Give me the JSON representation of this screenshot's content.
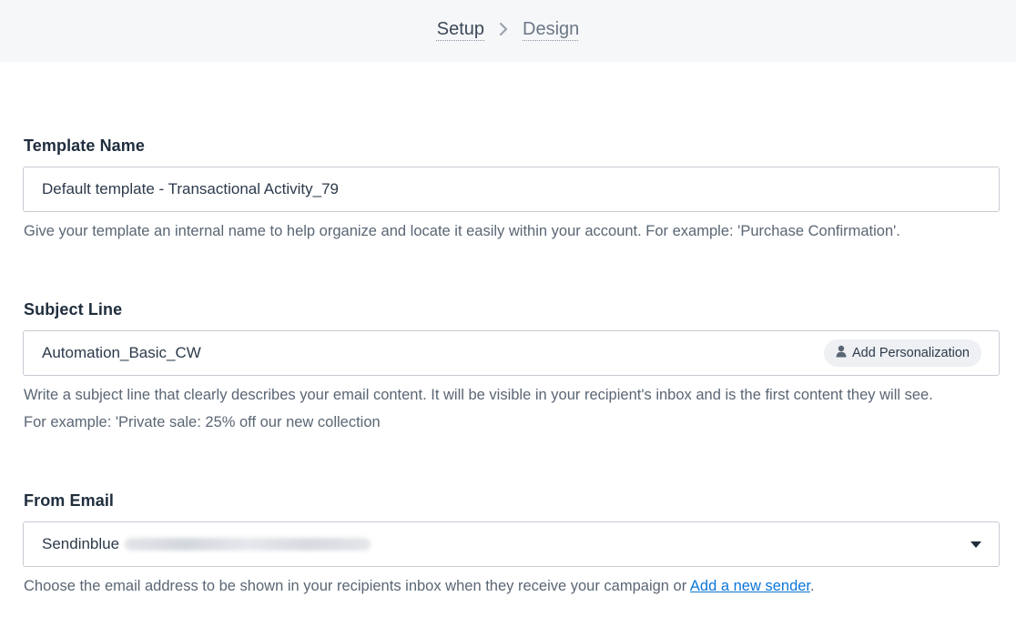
{
  "steps": [
    {
      "label": "Setup"
    },
    {
      "label": "Design"
    }
  ],
  "template_name": {
    "label": "Template Name",
    "value": "Default template - Transactional Activity_79",
    "help": "Give your template an internal name to help organize and locate it easily within your account. For example: 'Purchase Confirmation'."
  },
  "subject_line": {
    "label": "Subject Line",
    "value": "Automation_Basic_CW",
    "personalization_label": "Add Personalization",
    "help_line1": "Write a subject line that clearly describes your email content. It will be visible in your recipient's inbox and is the first content they will see.",
    "help_line2": "For example: 'Private sale: 25% off our new collection"
  },
  "from_email": {
    "label": "From Email",
    "selected_name": "Sendinblue",
    "help_prefix": "Choose the email address to be shown in your recipients inbox when they receive your campaign or ",
    "add_sender_link": "Add a new sender",
    "help_suffix": "."
  },
  "colors": {
    "link": "#0b76d8",
    "header_bg": "#f6f7f9",
    "border": "#c7ccd3"
  },
  "icons": {
    "step_separator": "chevron-right-icon",
    "personalization": "person-icon",
    "dropdown": "caret-down-icon"
  }
}
